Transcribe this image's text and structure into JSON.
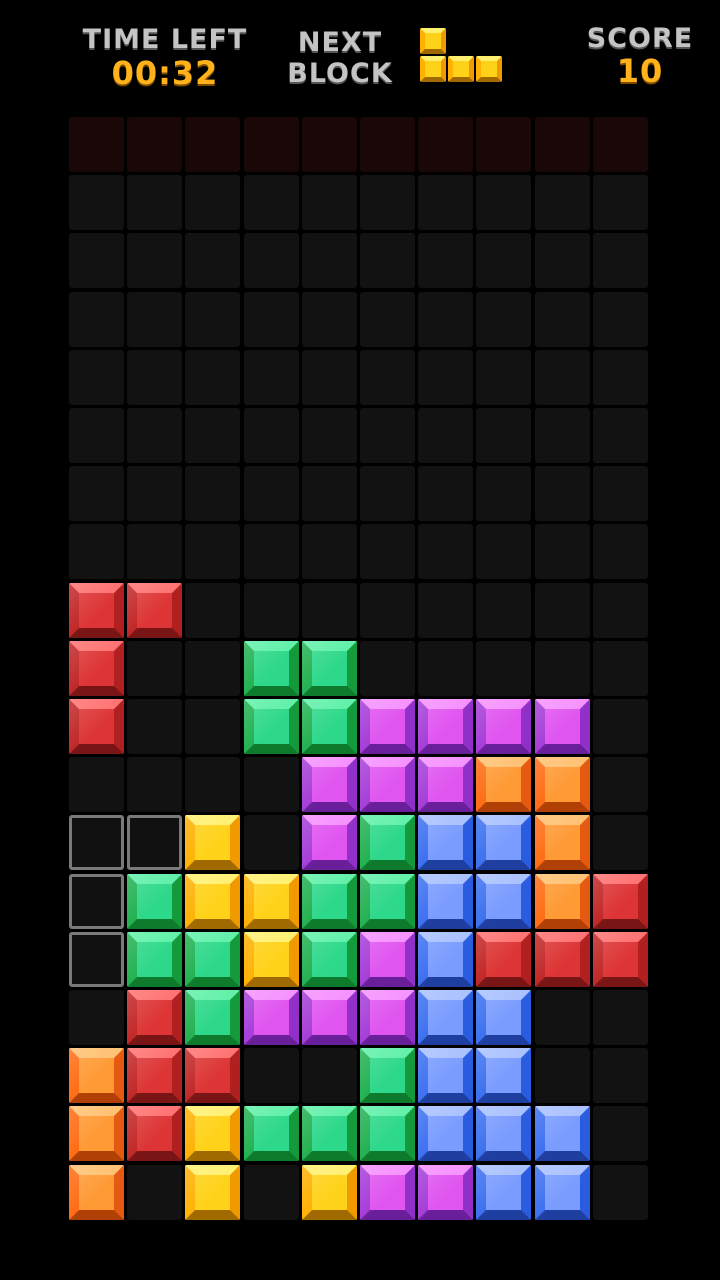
{
  "hud": {
    "time_label": "TIME LEFT",
    "time_value": "00:32",
    "next_label_line1": "NEXT",
    "next_label_line2": "BLOCK",
    "score_label": "SCORE",
    "score_value": "10"
  },
  "colors": {
    "red": {
      "face": "#dd3535",
      "top": "#ff7070",
      "left": "#c02424",
      "right": "#b02020",
      "bottom": "#7a1515"
    },
    "green": {
      "face": "#2ed88a",
      "top": "#5ef0a8",
      "left": "#1fb04f",
      "right": "#149a3a",
      "bottom": "#0e7a2c"
    },
    "purple": {
      "face": "#e055f0",
      "top": "#f590ff",
      "left": "#a43bd8",
      "right": "#9030c8",
      "bottom": "#6a1f9a"
    },
    "orange": {
      "face": "#ff9a35",
      "top": "#ffc070",
      "left": "#ff6a10",
      "right": "#e55a10",
      "bottom": "#b04006"
    },
    "blue": {
      "face": "#7a9cff",
      "top": "#a8c0ff",
      "left": "#3a6ef0",
      "right": "#2a5ce0",
      "bottom": "#1f3fa0"
    },
    "yellow": {
      "face": "#ffd21a",
      "top": "#fff070",
      "left": "#ffb000",
      "right": "#f09a00",
      "bottom": "#a06a00"
    }
  },
  "next_block": {
    "color": "yellow",
    "cells": [
      [
        0,
        0
      ],
      [
        0,
        1
      ],
      [
        1,
        1
      ],
      [
        2,
        1
      ]
    ]
  },
  "board": {
    "cols": 10,
    "rows": 19,
    "grid": [
      "DDDDDDDDDD",
      "..........",
      "..........",
      "..........",
      "..........",
      "..........",
      "..........",
      "..........",
      "RR........",
      "R..GG.....",
      "R..GGPPPP.",
      "....PPPOO.",
      "XXY.PGBBO.",
      "XGYYGGBBOR",
      "XGGYGPBRRR",
      ".RGPPPBB..",
      "ORR..GBB..",
      "ORYGGGBBB.",
      "O.Y.YPPBB."
    ],
    "legend": {
      "R": "red",
      "G": "green",
      "P": "purple",
      "O": "orange",
      "B": "blue",
      "Y": "yellow"
    }
  }
}
